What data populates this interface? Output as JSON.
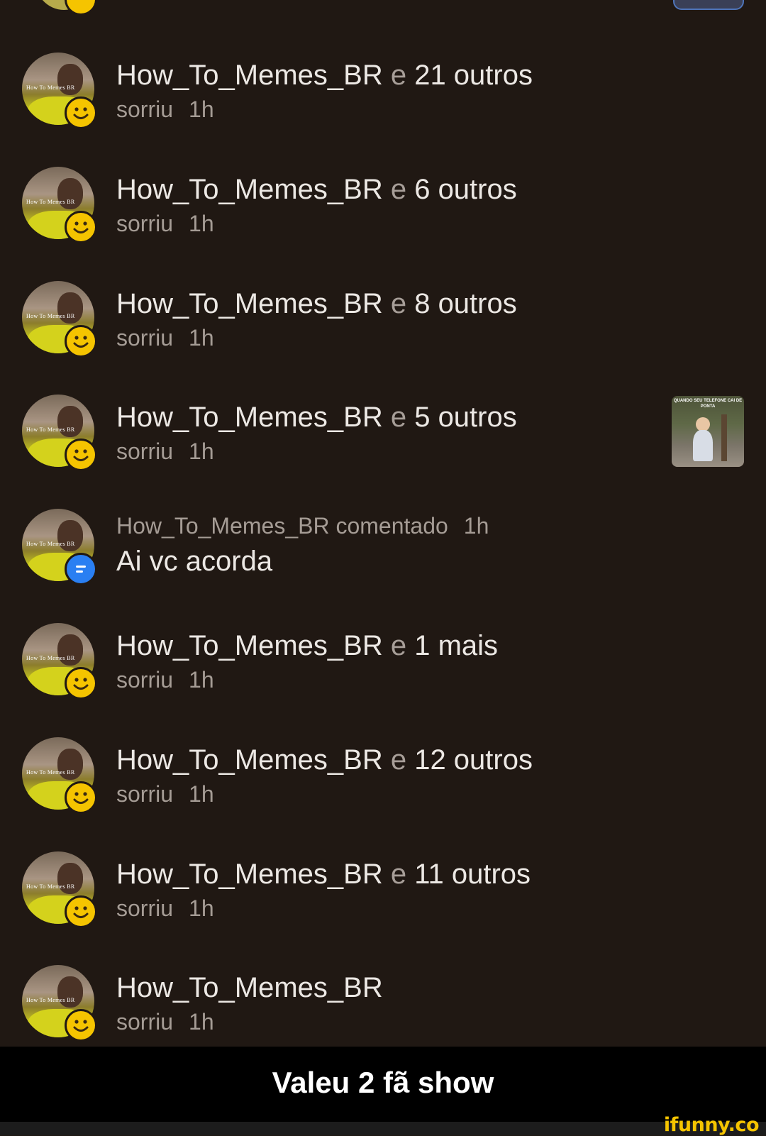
{
  "feed": {
    "items": [
      {
        "user": "How_To_Memes_BR",
        "conj": "e",
        "others": "21 outros",
        "action": "sorriu",
        "time": "1h"
      },
      {
        "user": "How_To_Memes_BR",
        "conj": "e",
        "others": "6 outros",
        "action": "sorriu",
        "time": "1h"
      },
      {
        "user": "How_To_Memes_BR",
        "conj": "e",
        "others": "8 outros",
        "action": "sorriu",
        "time": "1h"
      },
      {
        "user": "How_To_Memes_BR",
        "conj": "e",
        "others": "5 outros",
        "action": "sorriu",
        "time": "1h",
        "thumb_caption": "QUANDO SEU TELEFONE CAI DE PONTA"
      },
      {
        "user": "How_To_Memes_BR",
        "action": "comentado",
        "time": "1h",
        "comment": "Ai vc acorda"
      },
      {
        "user": "How_To_Memes_BR",
        "conj": "e",
        "others": "1 mais",
        "action": "sorriu",
        "time": "1h"
      },
      {
        "user": "How_To_Memes_BR",
        "conj": "e",
        "others": "12 outros",
        "action": "sorriu",
        "time": "1h"
      },
      {
        "user": "How_To_Memes_BR",
        "conj": "e",
        "others": "11 outros",
        "action": "sorriu",
        "time": "1h"
      },
      {
        "user": "How_To_Memes_BR",
        "action": "sorriu",
        "time": "1h"
      }
    ],
    "avatar_watermark": "How To Memes BR",
    "badge_icons": {
      "smile": "smile-icon",
      "comment": "comment-icon"
    },
    "colors": {
      "background": "#201813",
      "smile_badge": "#f5c400",
      "comment_badge": "#2a7ff2",
      "muted_text": "#a59c95"
    }
  },
  "caption": "Valeu 2 fã show",
  "brand": "ifunny.co"
}
